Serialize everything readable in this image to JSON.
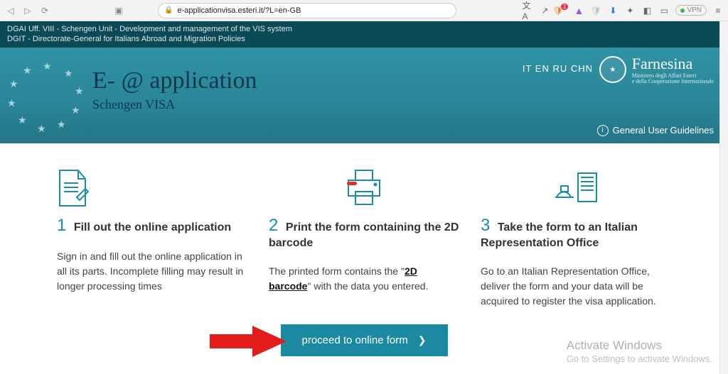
{
  "browser": {
    "url": "e-applicationvisa.esteri.it/?L=en-GB",
    "vpn_label": "VPN"
  },
  "top_strip": {
    "line1": "DGAI Uff. VIII - Schengen Unit - Development and management of the VIS system",
    "line2": "DGIT - Directorate-General for Italians Abroad and Migration Policies"
  },
  "header": {
    "title": "E- @ application",
    "subtitle": "Schengen VISA",
    "languages": "IT EN RU CHN",
    "logo_name": "Farnesina",
    "logo_sub1": "Ministero degli Affari Esteri",
    "logo_sub2": "e della Cooperazione Internazionale",
    "guidelines": "General User Guidelines"
  },
  "steps": [
    {
      "num": "1",
      "title": "Fill out the online application",
      "body": "Sign in and fill out the online application in all its parts. Incomplete filling may result in longer processing times"
    },
    {
      "num": "2",
      "title": "Print the form containing the 2D barcode",
      "body_pre": "The printed form contains the \"",
      "body_link": "2D barcode",
      "body_post": "\" with the data you entered."
    },
    {
      "num": "3",
      "title": "Take the form to an Italian Representation Office",
      "body": "Go to an Italian Representation Office, deliver the form and your data will be acquired to register the visa application."
    }
  ],
  "cta_label": "proceed to online form",
  "watermark": {
    "l1": "Activate Windows",
    "l2": "Go to Settings to activate Windows."
  }
}
